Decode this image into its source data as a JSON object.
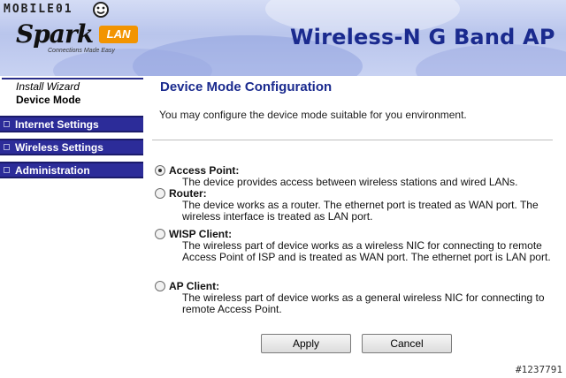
{
  "watermark": {
    "text": "MOBILE01",
    "icon": "mobile01-face-icon"
  },
  "header": {
    "logo_word": "Spark",
    "logo_badge": "LAN",
    "logo_tagline": "Connections Made Easy",
    "product_title": "Wireless-N G Band AP",
    "colors": {
      "title": "#1a2a8e",
      "badge": "#f29400",
      "banner": "#c3cdef"
    }
  },
  "sidebar": {
    "sub_items": [
      {
        "label": "Install Wizard"
      },
      {
        "label": "Device Mode"
      }
    ],
    "menu": [
      {
        "label": "Internet Settings"
      },
      {
        "label": "Wireless Settings"
      },
      {
        "label": "Administration"
      }
    ],
    "colors": {
      "menu_bg": "#2c2c99"
    }
  },
  "main": {
    "title": "Device Mode Configuration",
    "description": "You may configure the device mode suitable for you environment.",
    "modes": [
      {
        "label": "Access Point:",
        "desc": "The device provides access between wireless stations and wired LANs.",
        "checked": true
      },
      {
        "label": "Router:",
        "desc": "The device works as a router. The ethernet port is treated as WAN port. The wireless interface is treated as LAN port.",
        "checked": false
      },
      {
        "label": "WISP Client:",
        "desc": "The wireless part of device works as a wireless NIC for connecting to remote Access Point of ISP and is treated as WAN port. The ethernet port is LAN port.",
        "checked": false
      },
      {
        "label": "AP Client:",
        "desc": "The wireless part of device works as a general wireless NIC for connecting to remote Access Point.",
        "checked": false
      }
    ],
    "buttons": {
      "apply": "Apply",
      "cancel": "Cancel"
    }
  },
  "footer": {
    "id": "#1237791"
  }
}
